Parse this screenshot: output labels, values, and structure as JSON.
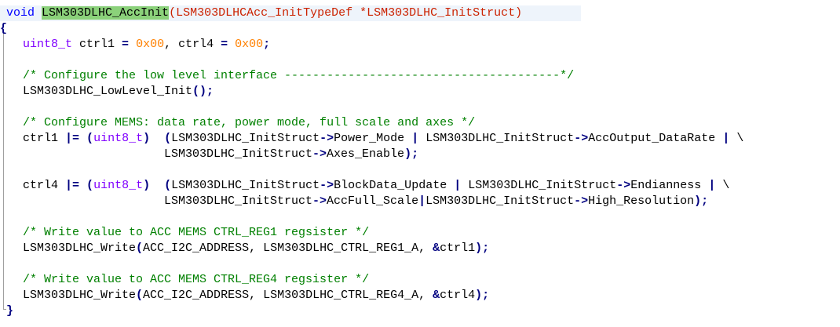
{
  "editor": {
    "lines": [
      {
        "id": "l1"
      },
      {
        "id": "l2"
      }
    ],
    "func_kw": "void",
    "func_name": "LSM303DLHC_AccInit",
    "func_open_paren": "(",
    "func_param_type": "LSM303DLHCAcc_InitTypeDef",
    "func_param": " *LSM303DLHC_InitStruct",
    "func_close_paren": ")",
    "open_brace": "{",
    "close_brace": "}",
    "decl_type": "uint8_t",
    "decl_name1": " ctrl1 ",
    "decl_eq1": "=",
    "decl_val1": "0x00",
    "decl_comma": ", ctrl4 ",
    "decl_eq2": "=",
    "decl_val2": "0x00",
    "decl_semi": ";",
    "comment_lowlevel": "/* Configure the low level interface ---------------------------------------*/",
    "lowlevel_call": "LSM303DLHC_LowLevel_Init",
    "lowlevel_parens": "();",
    "comment_mems": "/* Configure MEMS: data rate, power mode, full scale and axes */",
    "ctrl1_lhs": "ctrl1 ",
    "ctrl1_op": "|=",
    "ctrl1_cast_open": "(",
    "ctrl1_cast_type": "uint8_t",
    "ctrl1_cast_close": ")",
    "ctrl1_expr_open": "(",
    "ctrl1_expr_a": "LSM303DLHC_InitStruct",
    "ctrl1_arrow_a": "->",
    "ctrl1_field_a": "Power_Mode ",
    "ctrl1_or": "|",
    "ctrl1_expr_b": " LSM303DLHC_InitStruct",
    "ctrl1_arrow_b": "->",
    "ctrl1_field_b": "AccOutput_DataRate ",
    "ctrl1_or2": "|",
    "ctrl1_backslash": " \\",
    "ctrl1_cont_a": "LSM303DLHC_InitStruct",
    "ctrl1_cont_arrow": "->",
    "ctrl1_cont_field": "Axes_Enable",
    "ctrl1_cont_end": ");",
    "ctrl4_lhs": "ctrl4 ",
    "ctrl4_op": "|=",
    "ctrl4_cast_open": "(",
    "ctrl4_cast_type": "uint8_t",
    "ctrl4_cast_close": ")",
    "ctrl4_expr_open": "(",
    "ctrl4_expr_a": "LSM303DLHC_InitStruct",
    "ctrl4_arrow_a": "->",
    "ctrl4_field_a": "BlockData_Update ",
    "ctrl4_or": "|",
    "ctrl4_expr_b": " LSM303DLHC_InitStruct",
    "ctrl4_arrow_b": "->",
    "ctrl4_field_b": "Endianness ",
    "ctrl4_or2": "|",
    "ctrl4_backslash": " \\",
    "ctrl4_cont_a": "LSM303DLHC_InitStruct",
    "ctrl4_cont_arrow": "->",
    "ctrl4_cont_field": "AccFull_Scale",
    "ctrl4_cont_or": "|",
    "ctrl4_cont_b": "LSM303DLHC_InitStruct",
    "ctrl4_cont_arrow2": "->",
    "ctrl4_cont_field2": "High_Resolution",
    "ctrl4_cont_end": ");",
    "comment_reg1": "/* Write value to ACC MEMS CTRL_REG1 regsister */",
    "write1_fn": "LSM303DLHC_Write",
    "write1_open": "(",
    "write1_args": "ACC_I2C_ADDRESS, LSM303DLHC_CTRL_REG1_A, ",
    "write1_amp": "&",
    "write1_var": "ctrl1",
    "write1_end": ");",
    "comment_reg4": "/* Write value to ACC MEMS CTRL_REG4 regsister */",
    "write4_fn": "LSM303DLHC_Write",
    "write4_open": "(",
    "write4_args": "ACC_I2C_ADDRESS, LSM303DLHC_CTRL_REG4_A, ",
    "write4_amp": "&",
    "write4_var": "ctrl4",
    "write4_end": ");"
  },
  "colors": {
    "keyword": "#0000ff",
    "type": "#8000ff",
    "number": "#ff8000",
    "comment": "#008000",
    "selection": "#8bd17a",
    "current_line": "#eef4fb"
  }
}
